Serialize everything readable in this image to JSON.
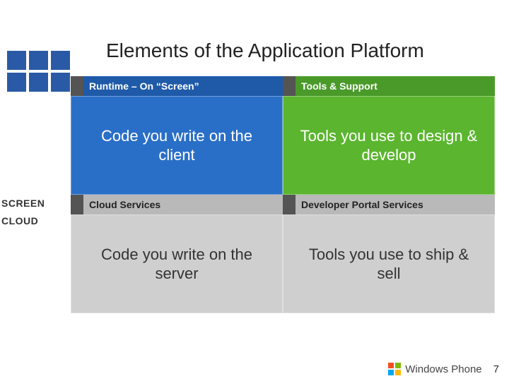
{
  "title": "Elements of the Application Platform",
  "logo": {
    "name": "grid-icon"
  },
  "side_labels": {
    "screen": "SCREEN",
    "cloud": "CLOUD"
  },
  "quadrants": {
    "top_left": {
      "tab": "Runtime – On “Screen”",
      "body": "Code you write on the client"
    },
    "top_right": {
      "tab": "Tools & Support",
      "body": "Tools you use to design & develop"
    },
    "bottom_left": {
      "tab": "Cloud Services",
      "body": "Code you write on the server"
    },
    "bottom_right": {
      "tab": "Developer Portal Services",
      "body": "Tools you use to ship & sell"
    }
  },
  "footer": {
    "brand": "Windows Phone",
    "page_number": "7"
  }
}
